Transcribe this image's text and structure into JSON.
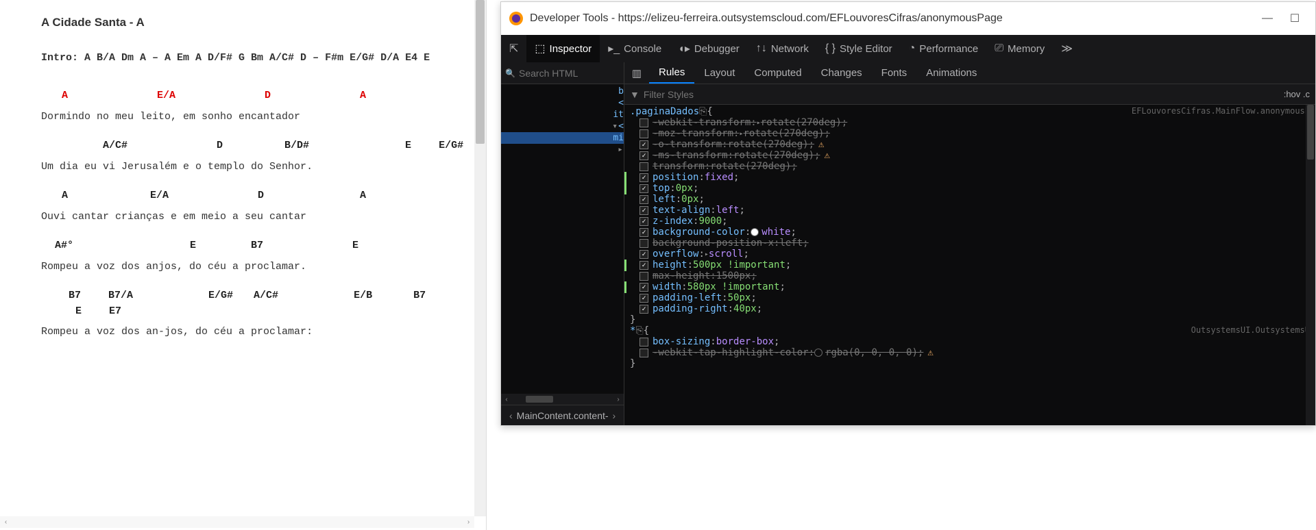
{
  "left": {
    "title": "A Cidade Santa - A",
    "intro": "Intro: A  B/A  Dm   A – A   Em   A  D/F#   G   Bm  A/C#  D –   F#m  E/G#  D/A  E4  E",
    "lines": [
      {
        "type": "chords",
        "style": "red",
        "spacing": [
          30,
          130,
          130,
          130
        ],
        "chords": [
          "A",
          "E/A",
          "D",
          "A"
        ]
      },
      {
        "type": "lyric",
        "text": "Dormindo no meu leito, em sonho encantador"
      },
      {
        "type": "chords",
        "style": "bold",
        "spacing": [
          90,
          130,
          90,
          140,
          40
        ],
        "chords": [
          "A/C#",
          "D",
          "B/D#",
          "E",
          "E/G#"
        ]
      },
      {
        "type": "lyric",
        "text": "Um dia eu vi   Jerusalém e o templo do Senhor."
      },
      {
        "type": "chords",
        "style": "bold",
        "spacing": [
          30,
          120,
          130,
          140
        ],
        "chords": [
          "A",
          "E/A",
          "D",
          "A"
        ]
      },
      {
        "type": "lyric",
        "text": "Ouvi cantar crianças e em meio a seu cantar"
      },
      {
        "type": "chords",
        "style": "bold",
        "spacing": [
          20,
          170,
          80,
          130
        ],
        "chords": [
          "A#°",
          "E",
          "B7",
          "E"
        ]
      },
      {
        "type": "lyric",
        "text": "Rompeu a voz dos anjos, do céu a proclamar."
      },
      {
        "type": "chords",
        "style": "bold",
        "spacing": [
          40,
          40,
          110,
          30,
          110,
          60,
          50,
          40
        ],
        "chords": [
          "B7",
          "B7/A",
          "E/G#",
          "A/C#",
          "E/B",
          "B7",
          "E",
          "E7"
        ]
      },
      {
        "type": "lyric",
        "text": "Rompeu   a voz  dos  an-jos,   do céu a proclamar:"
      }
    ]
  },
  "devtools": {
    "window_title": "Developer Tools - https://elizeu-ferreira.outsystemscloud.com/EFLouvoresCifras/anonymousPage",
    "tabs": [
      {
        "icon": "⇱",
        "label": ""
      },
      {
        "icon": "⬚",
        "label": "Inspector",
        "active": true
      },
      {
        "icon": "▸_",
        "label": "Console"
      },
      {
        "icon": "◖▸",
        "label": "Debugger"
      },
      {
        "icon": "↑↓",
        "label": "Network"
      },
      {
        "icon": "{ }",
        "label": "Style Editor"
      },
      {
        "icon": "◔",
        "label": "Performance"
      },
      {
        "icon": "⎚",
        "label": "Memory"
      },
      {
        "icon": "≫",
        "label": ""
      }
    ],
    "search_placeholder": "Search HTML",
    "tree_fragments": [
      "b",
      "<",
      "it",
      "<",
      "mi",
      ""
    ],
    "breadcrumb": "MainContent.content-",
    "rules_tabs": [
      "Rules",
      "Layout",
      "Computed",
      "Changes",
      "Fonts",
      "Animations"
    ],
    "filter_placeholder": "Filter Styles",
    "hov_label": ":hov   .c",
    "rule": {
      "selector": ".paginaDados",
      "origin": "EFLouvoresCifras.MainFlow.anonymousP",
      "decls": [
        {
          "checked": false,
          "struck": true,
          "prop": "-webkit-transform",
          "val": "rotate(270deg)",
          "expander": true
        },
        {
          "checked": false,
          "struck": true,
          "prop": "-moz-transform",
          "val": "rotate(270deg)",
          "expander": true
        },
        {
          "checked": true,
          "struck": true,
          "prop": "-o-transform",
          "val": "rotate(270deg)",
          "warn": true
        },
        {
          "checked": true,
          "struck": true,
          "prop": "-ms-transform",
          "val": "rotate(270deg)",
          "warn": true
        },
        {
          "checked": false,
          "struck": true,
          "prop": "transform",
          "val": "rotate(270deg)"
        },
        {
          "checked": true,
          "prop": "position",
          "val": "fixed",
          "kw": true,
          "changed": true
        },
        {
          "checked": true,
          "prop": "top",
          "val": "0px",
          "changed": true
        },
        {
          "checked": true,
          "prop": "left",
          "val": "0px"
        },
        {
          "checked": true,
          "prop": "text-align",
          "val": "left",
          "kw": true
        },
        {
          "checked": true,
          "prop": "z-index",
          "val": "9000"
        },
        {
          "checked": true,
          "prop": "background-color",
          "val": "white",
          "swatch": "#ffffff",
          "kw": true
        },
        {
          "checked": false,
          "struck": true,
          "prop": "background-position-x",
          "val": "left"
        },
        {
          "checked": true,
          "prop": "overflow",
          "val": "scroll",
          "kw": true,
          "expander": true
        },
        {
          "checked": true,
          "prop": "height",
          "val": "500px !important",
          "changed": true
        },
        {
          "checked": false,
          "struck": true,
          "prop": "max-height",
          "val": "1500px"
        },
        {
          "checked": true,
          "prop": "width",
          "val": "580px !important",
          "changed": true
        },
        {
          "checked": true,
          "prop": "padding-left",
          "val": "50px"
        },
        {
          "checked": true,
          "prop": "padding-right",
          "val": "40px"
        }
      ]
    },
    "rule2": {
      "selector": "*",
      "origin": "OutsystemsUI.OutsystemsU",
      "decls": [
        {
          "checked": false,
          "prop": "box-sizing",
          "val": "border-box",
          "kw": true
        },
        {
          "checked": false,
          "struck": true,
          "prop": "-webkit-tap-highlight-color",
          "val": "rgba(0, 0, 0, 0)",
          "warn": true,
          "swatch": "rgba(0,0,0,0)"
        }
      ]
    }
  }
}
